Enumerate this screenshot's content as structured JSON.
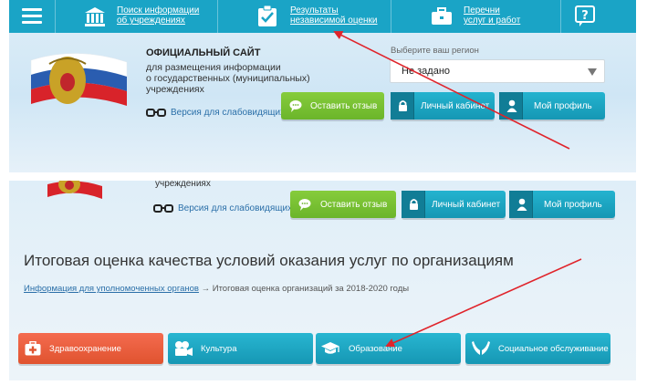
{
  "header": {
    "nav_items": [
      {
        "line1": "Поиск информации",
        "line2": "об учреждениях",
        "icon": "institution-icon"
      },
      {
        "line1": "Результаты",
        "line2": "независимой оценки",
        "icon": "checklist-icon"
      },
      {
        "line1": "Перечни",
        "line2": "услуг и работ",
        "icon": "briefcase-icon"
      }
    ],
    "help_icon": "question-icon"
  },
  "site": {
    "title": "ОФИЦИАЛЬНЫЙ САЙТ",
    "subtitle_lines": [
      "для размещения информации",
      "о государственных (муниципальных)",
      "учреждениях"
    ],
    "subtitle_last": "учреждениях",
    "vision_link": "Версия для слабовидящих"
  },
  "region": {
    "label": "Выберите ваш регион",
    "value": "Не задано"
  },
  "actions": {
    "feedback": "Оставить отзыв",
    "cabinet": "Личный кабинет",
    "profile": "Мой профиль"
  },
  "page": {
    "heading": "Итоговая оценка качества условий оказания услуг по организациям",
    "breadcrumb_link": "Информация для уполномоченных органов",
    "breadcrumb_sep": "→",
    "breadcrumb_current": "Итоговая оценка организаций за 2018-2020 годы"
  },
  "categories": [
    {
      "label": "Здравоохранение",
      "icon": "medical-case-icon"
    },
    {
      "label": "Культура",
      "icon": "film-camera-icon"
    },
    {
      "label": "Образование",
      "icon": "graduation-cap-icon"
    },
    {
      "label": "Социальное обслуживание",
      "icon": "helping-hands-icon"
    }
  ],
  "colors": {
    "nav_bg": "#1aa4c6",
    "green_button": "#6bb52a",
    "teal_button": "#1597b4",
    "red_button": "#e0532f",
    "annotation_arrow": "#e0242b"
  }
}
